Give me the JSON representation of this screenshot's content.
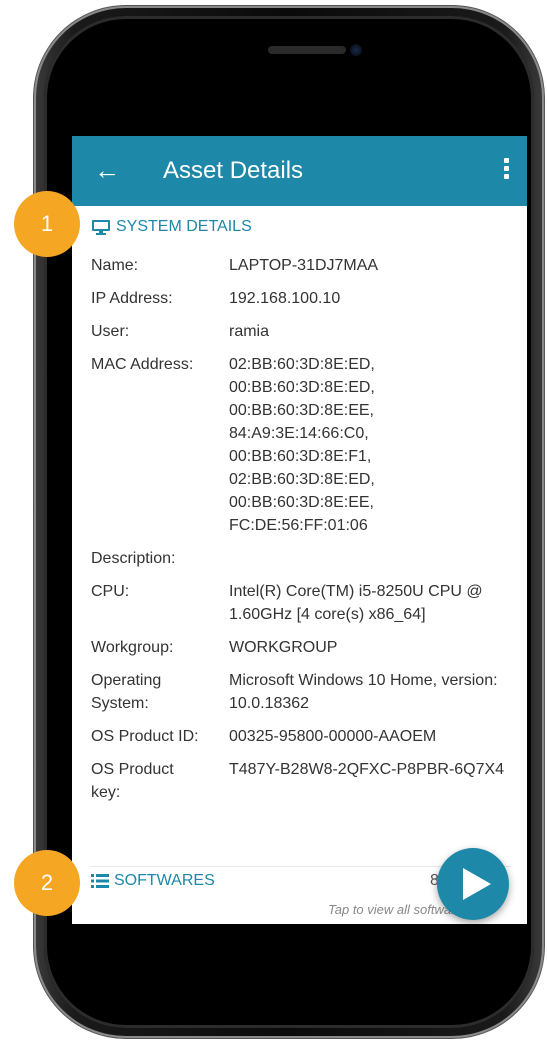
{
  "appbar": {
    "title": "Asset Details",
    "back_icon": "arrow-left-icon",
    "menu_icon": "more-vertical-icon",
    "color": "#1e88a8"
  },
  "system_details": {
    "heading": "SYSTEM DETAILS",
    "icon": "monitor-icon",
    "rows": [
      {
        "label": "Name:",
        "value": "LAPTOP-31DJ7MAA"
      },
      {
        "label": "IP Address:",
        "value": "192.168.100.10"
      },
      {
        "label": "User:",
        "value": "ramia"
      },
      {
        "label": "MAC Address:",
        "value": "02:BB:60:3D:8E:ED,\n00:BB:60:3D:8E:ED,\n00:BB:60:3D:8E:EE,\n84:A9:3E:14:66:C0,\n00:BB:60:3D:8E:F1,\n02:BB:60:3D:8E:ED,\n00:BB:60:3D:8E:EE,\nFC:DE:56:FF:01:06"
      },
      {
        "label": "Description:",
        "value": ""
      },
      {
        "label": "CPU:",
        "value": "Intel(R) Core(TM) i5-8250U CPU @ 1.60GHz [4 core(s) x86_64]"
      },
      {
        "label": "Workgroup:",
        "value": "WORKGROUP"
      },
      {
        "label": "Operating System:",
        "value": "Microsoft Windows 10 Home, version: 10.0.18362"
      },
      {
        "label": "OS Product ID:",
        "value": "00325-95800-00000-AAOEM"
      },
      {
        "label": "OS Product key:",
        "value": "T487Y-B28W8-2QFXC-P8PBR-6Q7X4"
      }
    ]
  },
  "softwares": {
    "heading": "SOFTWARES",
    "icon": "list-icon",
    "count": "8",
    "hint": "Tap to view all softwares",
    "fab_icon": "play-icon"
  },
  "badges": [
    "1",
    "2"
  ],
  "badge_color": "#f5a623"
}
